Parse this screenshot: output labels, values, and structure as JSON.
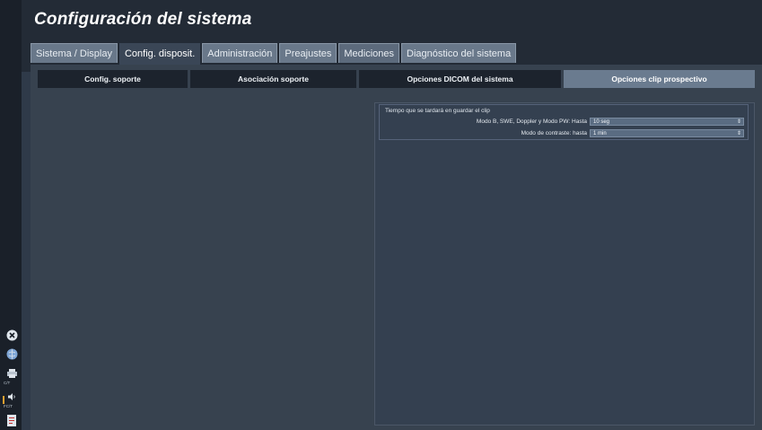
{
  "header": {
    "title": "Configuración del sistema"
  },
  "tabs": [
    {
      "label": "Sistema / Display",
      "active": false
    },
    {
      "label": "Config. disposit.",
      "active": true
    },
    {
      "label": "Administración",
      "active": false
    },
    {
      "label": "Preajustes",
      "active": false
    },
    {
      "label": "Mediciones",
      "active": false
    },
    {
      "label": "Diagnóstico del sistema",
      "active": false
    }
  ],
  "subtabs": [
    {
      "label": "Config. soporte",
      "active": false
    },
    {
      "label": "Asociación soporte",
      "active": false
    },
    {
      "label": "Opciones DICOM del sistema",
      "active": false
    },
    {
      "label": "Opciones clip prospectivo",
      "active": true
    }
  ],
  "clip_options": {
    "group_title": "Tiempo que se tardará en guardar el clip",
    "rows": [
      {
        "label": "Modo B, SWE, Doppler y Modo PW: Hasta",
        "value": "10 seg"
      },
      {
        "label": "Modo de contraste: hasta",
        "value": "1 min"
      }
    ]
  },
  "left_rail": {
    "icons": [
      "close-circle-icon",
      "globe-icon",
      "printer-icon",
      "speaker-icon",
      "document-icon"
    ],
    "printer_label": "C/T",
    "speaker_label": "FC/T"
  },
  "colors": {
    "background": "#2f3a49",
    "header": "#232b36",
    "tab": "#69788a",
    "tab_active": "#3a4656",
    "subtab": "#1c232d",
    "subtab_active": "#6a7b8f",
    "select": "#5a6c82",
    "accent": "#e0a030"
  }
}
